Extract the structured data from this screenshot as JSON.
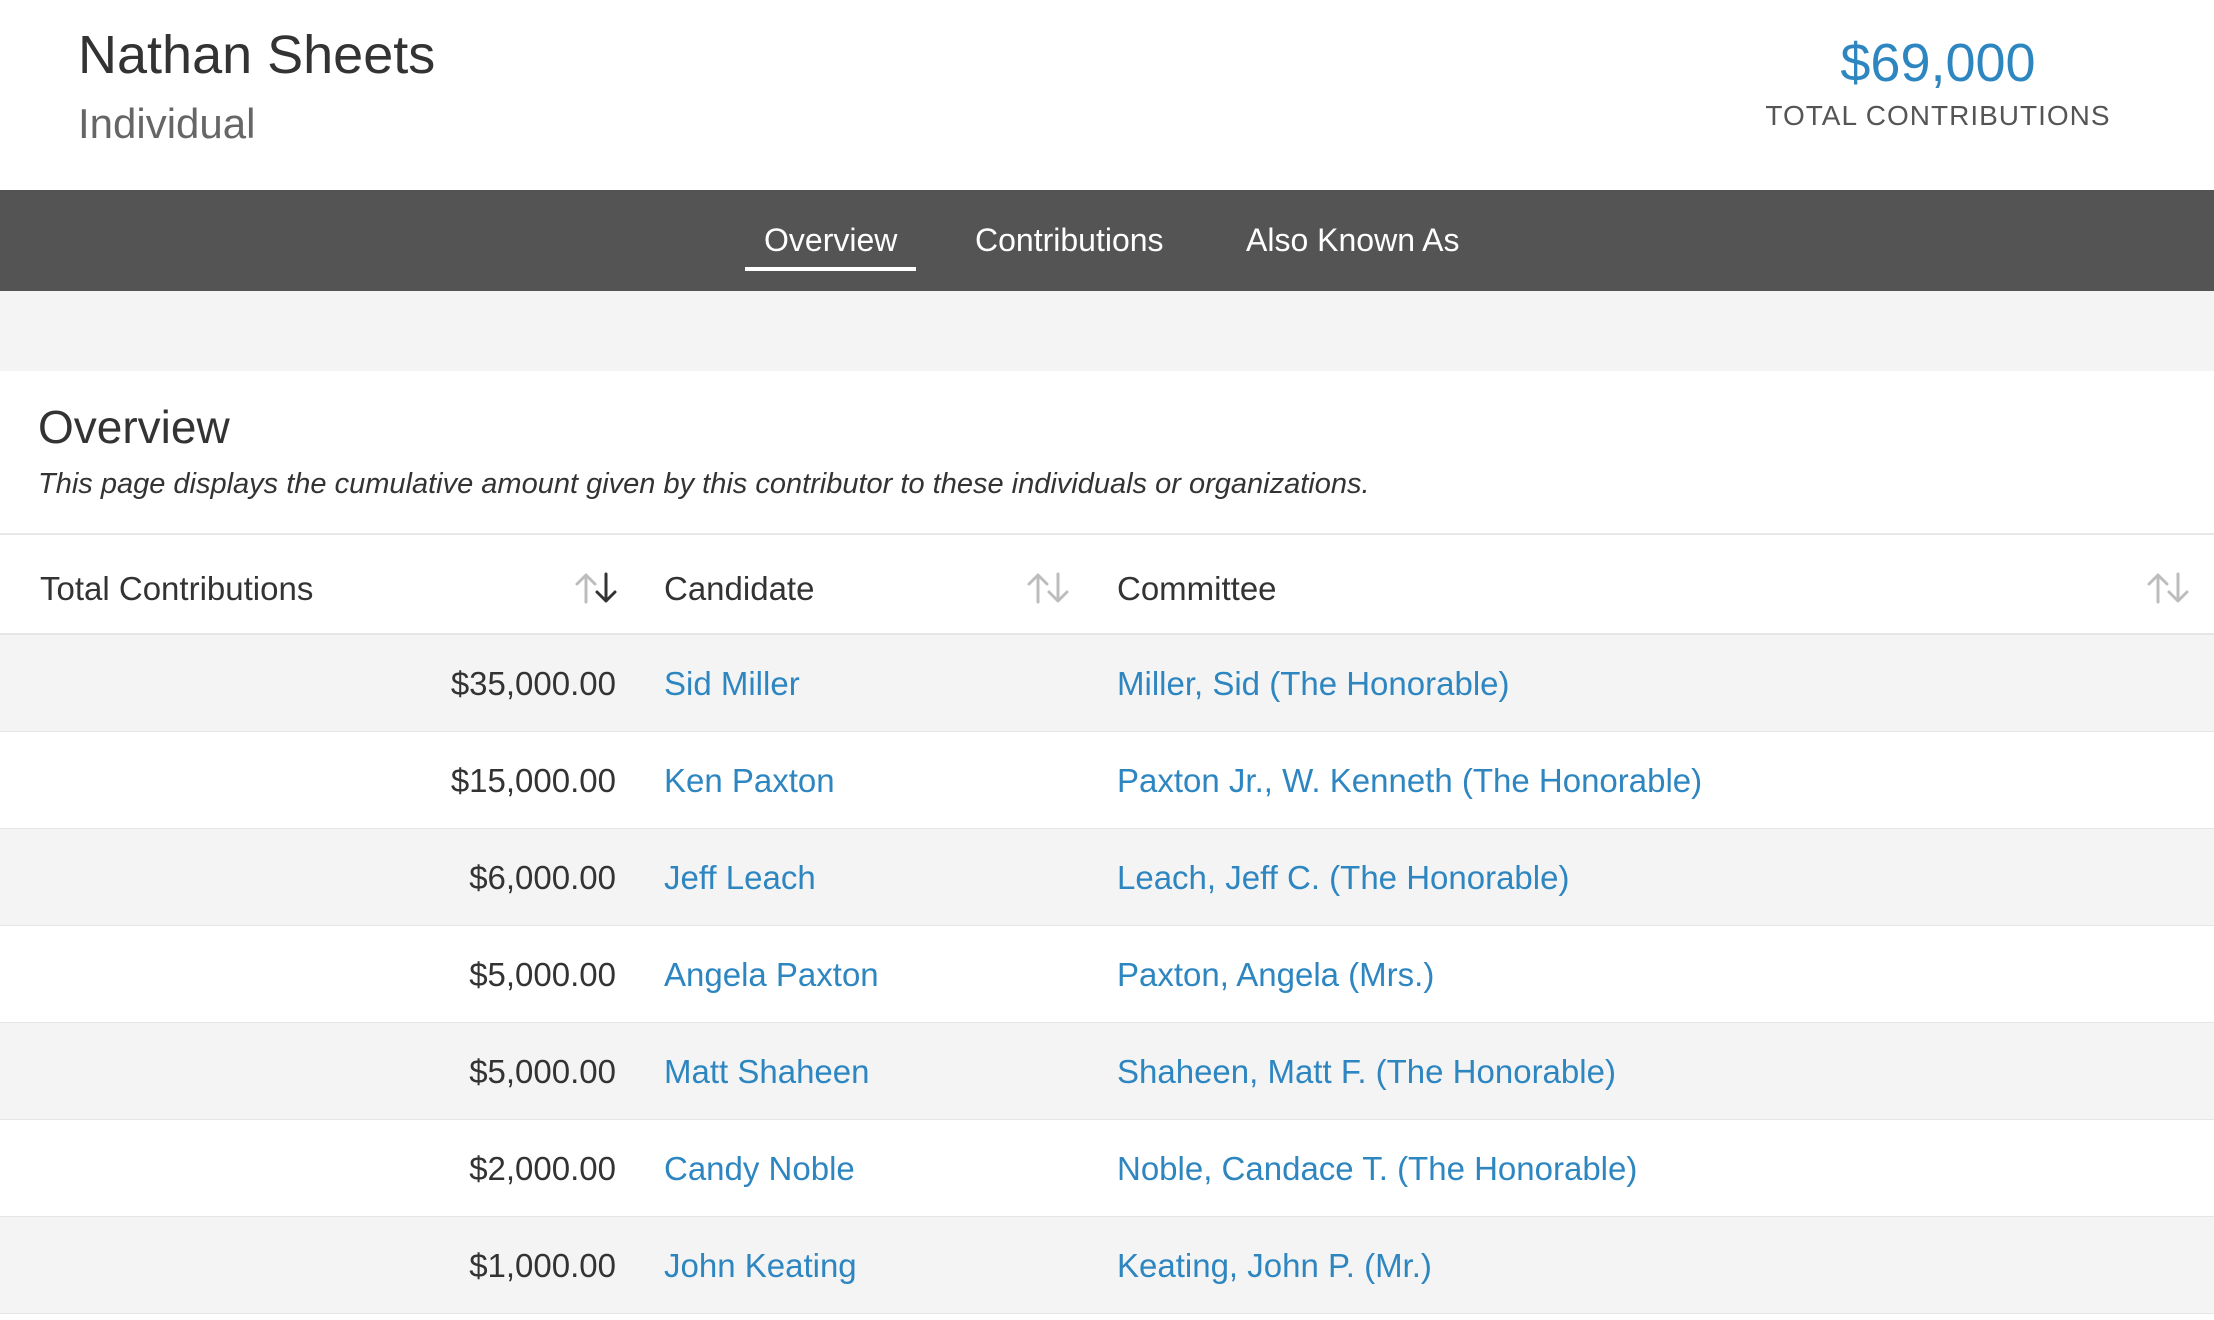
{
  "profile": {
    "name": "Nathan Sheets",
    "type": "Individual",
    "total_amount": "$69,000",
    "total_label": "TOTAL CONTRIBUTIONS"
  },
  "nav": {
    "tabs": [
      {
        "label": "Overview",
        "active": true
      },
      {
        "label": "Contributions",
        "active": false
      },
      {
        "label": "Also Known As",
        "active": false
      }
    ]
  },
  "overview": {
    "title": "Overview",
    "description": "This page displays the cumulative amount given by this contributor to these individuals or organizations."
  },
  "table": {
    "columns": [
      "Total Contributions",
      "Candidate",
      "Committee"
    ],
    "sorted_column": "Total Contributions",
    "sort_direction": "descending",
    "rows": [
      {
        "amount": "$35,000.00",
        "candidate": "Sid Miller",
        "committee": "Miller, Sid (The Honorable)"
      },
      {
        "amount": "$15,000.00",
        "candidate": "Ken Paxton",
        "committee": "Paxton Jr., W. Kenneth (The Honorable)"
      },
      {
        "amount": "$6,000.00",
        "candidate": "Jeff Leach",
        "committee": "Leach, Jeff C. (The Honorable)"
      },
      {
        "amount": "$5,000.00",
        "candidate": "Angela Paxton",
        "committee": "Paxton, Angela (Mrs.)"
      },
      {
        "amount": "$5,000.00",
        "candidate": "Matt Shaheen",
        "committee": "Shaheen, Matt F. (The Honorable)"
      },
      {
        "amount": "$2,000.00",
        "candidate": "Candy Noble",
        "committee": "Noble, Candace T. (The Honorable)"
      },
      {
        "amount": "$1,000.00",
        "candidate": "John Keating",
        "committee": "Keating, John P. (Mr.)"
      }
    ]
  },
  "colors": {
    "link": "#2e86c1",
    "nav_bg": "#545454",
    "row_alt": "#f4f4f4"
  },
  "icons": {
    "sort_active": "sort-desc-icon",
    "sort_inactive": "sort-icon"
  }
}
